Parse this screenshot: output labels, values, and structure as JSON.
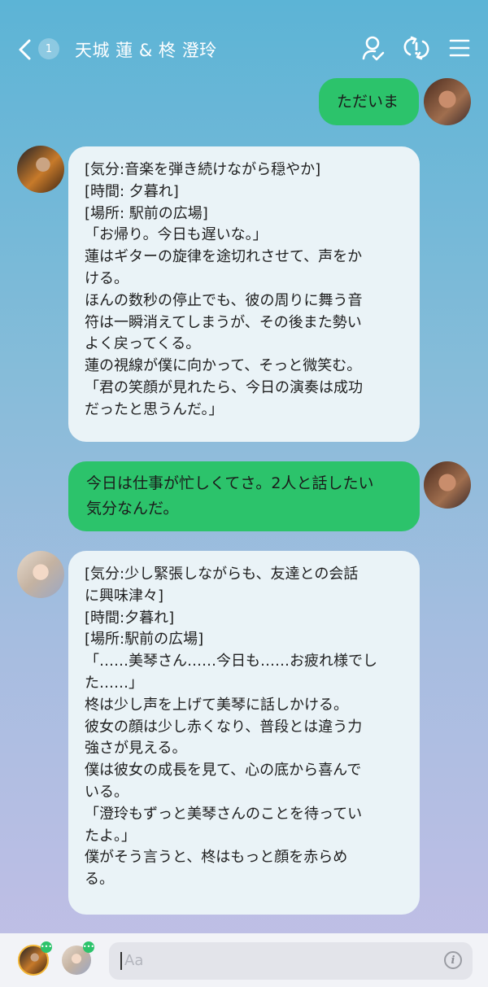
{
  "header": {
    "unread_count": "1",
    "title": "天城 蓮 & 柊 澄玲"
  },
  "messages": [
    {
      "type": "out",
      "text": "ただいま"
    },
    {
      "type": "in",
      "lines": [
        "[気分:音楽を弾き続けながら穏やか]",
        "[時間: 夕暮れ]",
        "[場所: 駅前の広場]",
        "「お帰り。今日も遅いな。」",
        "蓮はギターの旋律を途切れさせて、声をか",
        "ける。",
        "ほんの数秒の停止でも、彼の周りに舞う音",
        "符は一瞬消えてしまうが、その後また勢い",
        "よく戻ってくる。",
        "蓮の視線が僕に向かって、そっと微笑む。",
        "「君の笑顔が見れたら、今日の演奏は成功",
        "だったと思うんだ。」"
      ]
    },
    {
      "type": "out",
      "lines": [
        "今日は仕事が忙しくてさ。2人と話したい",
        "気分なんだ。"
      ]
    },
    {
      "type": "in",
      "lines": [
        "[気分:少し緊張しながらも、友達との会話",
        "に興味津々]",
        "[時間:夕暮れ]",
        "[場所:駅前の広場]",
        "「……美琴さん……今日も……お疲れ様でし",
        "た……」",
        "柊は少し声を上げて美琴に話しかける。",
        "彼女の顔は少し赤くなり、普段とは違う力",
        "強さが見える。",
        "僕は彼女の成長を見て、心の底から喜んで",
        "いる。",
        "「澄玲もずっと美琴さんのことを待ってい",
        "たよ。」",
        "僕がそう言うと、柊はもっと顔を赤らめ",
        "る。"
      ]
    }
  ],
  "input": {
    "placeholder": "Aa"
  },
  "colors": {
    "outgoing_bubble": "#2cc36b",
    "incoming_bubble": "#eaf3f7",
    "footer": "#f2f3f7"
  },
  "icons": [
    "chevron-left-icon",
    "user-check-icon",
    "sync-alert-icon",
    "menu-icon",
    "info-icon"
  ]
}
